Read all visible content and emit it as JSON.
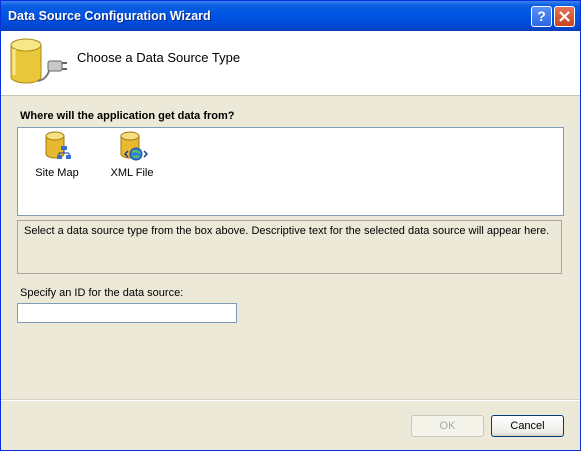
{
  "window": {
    "title": "Data Source Configuration Wizard",
    "help_label": "?"
  },
  "header": {
    "title": "Choose a Data Source Type"
  },
  "main": {
    "question": "Where will the application get data from?",
    "sources": [
      {
        "label": "Site Map",
        "icon": "site-map-icon"
      },
      {
        "label": "XML File",
        "icon": "xml-file-icon"
      }
    ],
    "description": "Select a data source type from the box above. Descriptive text for the selected data source will appear here.",
    "id_label": "Specify an ID for the data source:",
    "id_value": ""
  },
  "footer": {
    "ok_label": "OK",
    "cancel_label": "Cancel",
    "ok_enabled": false
  }
}
